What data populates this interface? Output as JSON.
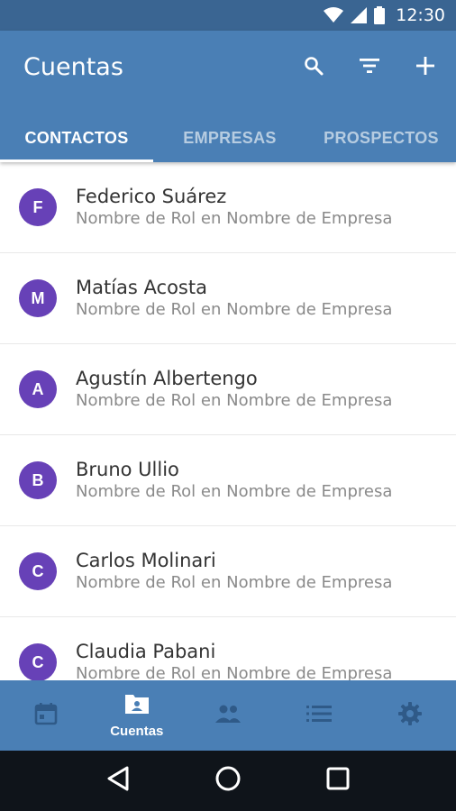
{
  "status_bar": {
    "time": "12:30"
  },
  "app_bar": {
    "title": "Cuentas",
    "actions": [
      {
        "name": "search-icon"
      },
      {
        "name": "filter-icon"
      },
      {
        "name": "add-icon"
      }
    ]
  },
  "tabs": [
    {
      "label": "CONTACTOS",
      "active": true
    },
    {
      "label": "EMPRESAS",
      "active": false
    },
    {
      "label": "PROSPECTOS",
      "active": false
    }
  ],
  "contacts": [
    {
      "initial": "F",
      "name": "Federico Suárez",
      "subtitle": "Nombre de Rol en Nombre de Empresa"
    },
    {
      "initial": "M",
      "name": "Matías Acosta",
      "subtitle": "Nombre de Rol en Nombre de Empresa"
    },
    {
      "initial": "A",
      "name": "Agustín Albertengo",
      "subtitle": "Nombre de Rol en Nombre de Empresa"
    },
    {
      "initial": "B",
      "name": "Bruno Ullio",
      "subtitle": "Nombre de Rol en Nombre de Empresa"
    },
    {
      "initial": "C",
      "name": "Carlos Molinari",
      "subtitle": "Nombre de Rol en Nombre de Empresa"
    },
    {
      "initial": "C",
      "name": "Claudia Pabani",
      "subtitle": "Nombre de Rol en Nombre de Empresa"
    }
  ],
  "bottom_nav": [
    {
      "icon": "calendar-icon",
      "label": ""
    },
    {
      "icon": "contact-card-icon",
      "label": "Cuentas",
      "active": true
    },
    {
      "icon": "people-icon",
      "label": ""
    },
    {
      "icon": "list-icon",
      "label": ""
    },
    {
      "icon": "settings-icon",
      "label": ""
    }
  ],
  "colors": {
    "status_bar": "#3a6592",
    "app_bar": "#4a7fb5",
    "avatar": "#6741b7",
    "system_nav": "#0f141a"
  }
}
